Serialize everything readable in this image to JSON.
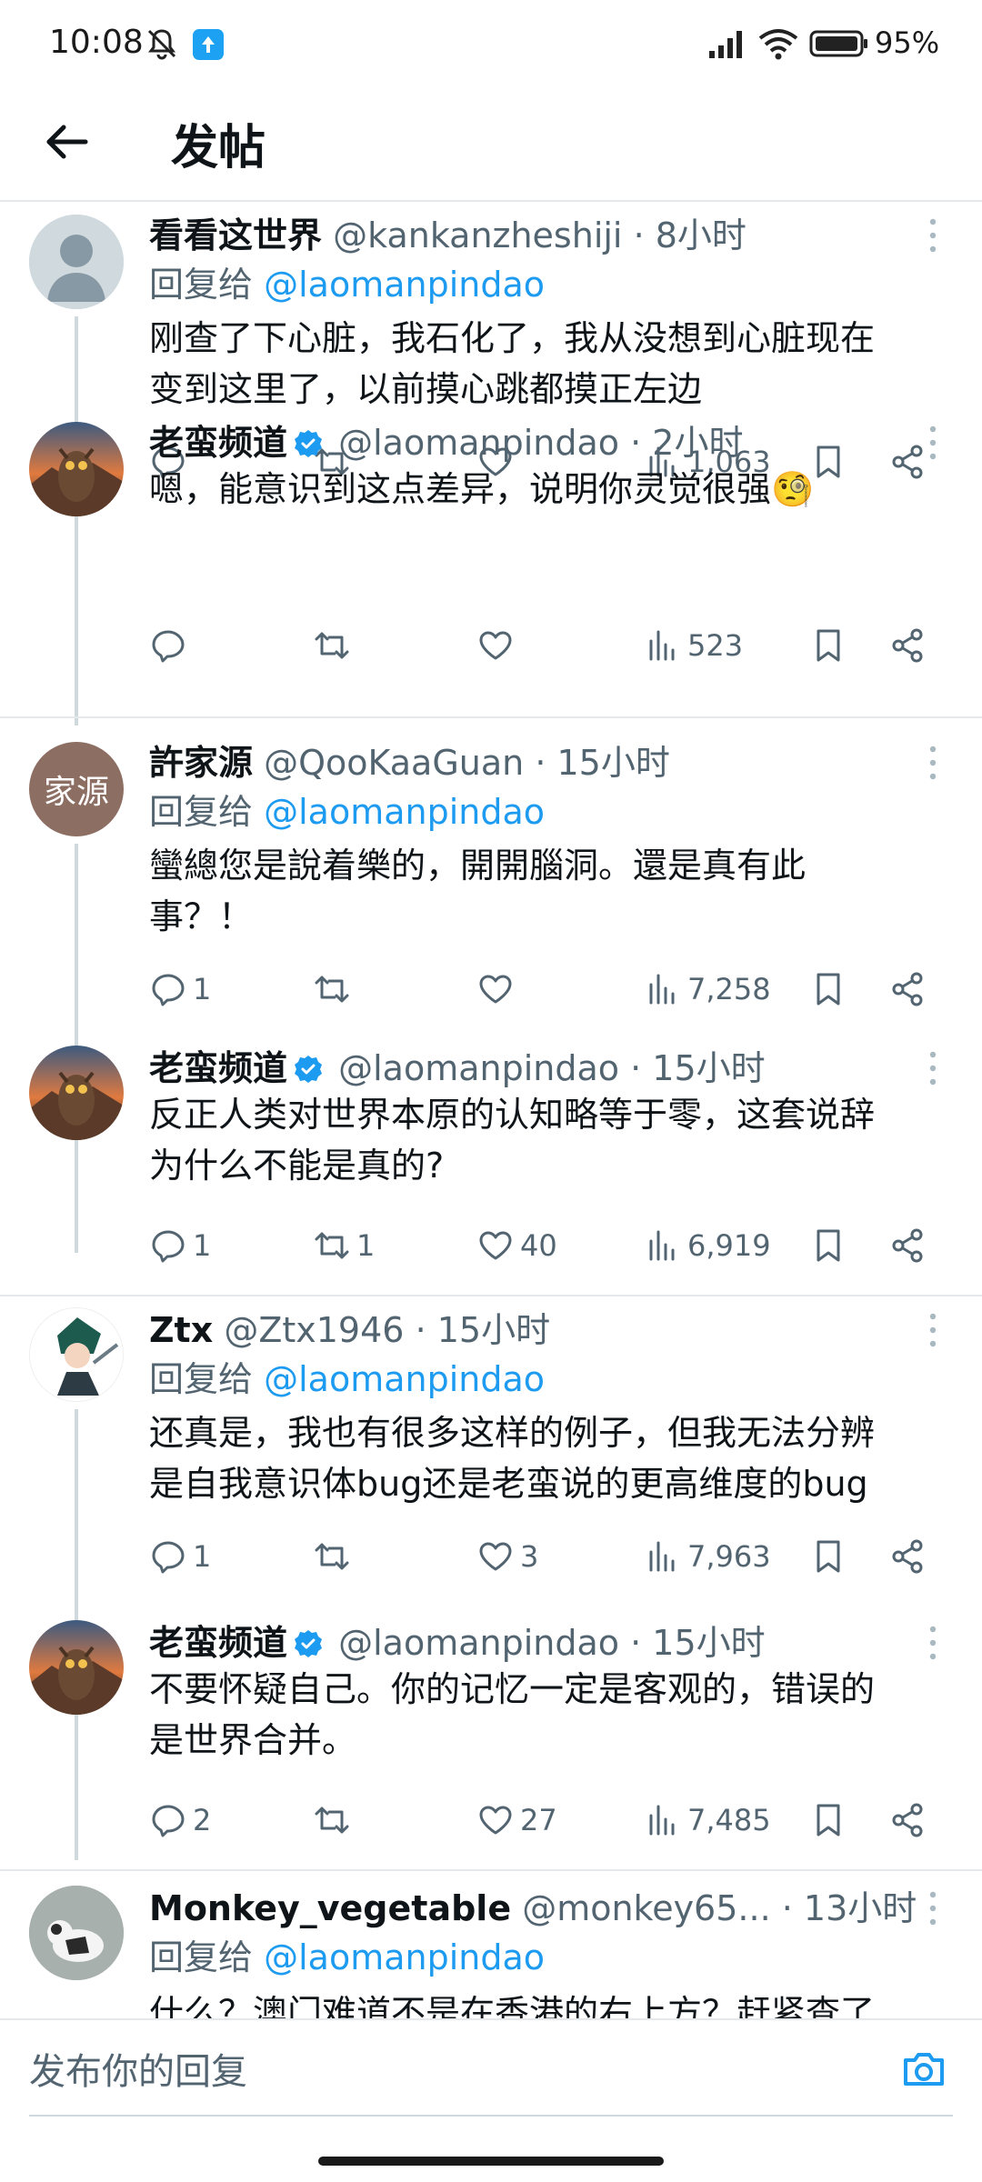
{
  "status_bar": {
    "time": "10:08",
    "battery": "95%"
  },
  "header": {
    "title": "发帖"
  },
  "colors": {
    "accent": "#1d9bf0",
    "secondary_text": "#536471",
    "divider": "#e6e9ec"
  },
  "tweets": [
    {
      "name": "看看这世界",
      "handle": "@kankanzheshiji",
      "time": "· 8小时",
      "verified": false,
      "reply_label": "回复给",
      "reply_handle": "@laomanpindao",
      "text": "刚查了下心脏，我石化了，我从没想到心脏现在\n变到这里了，以前摸心跳都摸正左边",
      "replies": "",
      "retweets": "",
      "likes": "",
      "views": "1,063"
    },
    {
      "name": "老蛮频道",
      "handle": "@laomanpindao",
      "time": "· 2小时",
      "verified": true,
      "text": "嗯，能意识到这点差异，说明你灵觉很强🧐",
      "replies": "",
      "retweets": "",
      "likes": "",
      "views": "523"
    },
    {
      "name": "許家源",
      "handle": "@QooKaaGuan",
      "time": "· 15小时",
      "verified": false,
      "avatar_text": "家源",
      "reply_label": "回复给",
      "reply_handle": "@laomanpindao",
      "text": "蠻總您是說着樂的，開開腦洞。還是真有此\n事？！",
      "replies": "1",
      "retweets": "",
      "likes": "",
      "views": "7,258"
    },
    {
      "name": "老蛮频道",
      "handle": "@laomanpindao",
      "time": "· 15小时",
      "verified": true,
      "text": "反正人类对世界本原的认知略等于零，这套说辞\n为什么不能是真的?",
      "replies": "1",
      "retweets": "1",
      "likes": "40",
      "views": "6,919"
    },
    {
      "name": "Ztx",
      "handle": "@Ztx1946",
      "time": "· 15小时",
      "verified": false,
      "reply_label": "回复给",
      "reply_handle": "@laomanpindao",
      "text": "还真是，我也有很多这样的例子，但我无法分辨\n是自我意识体bug还是老蛮说的更高维度的bug",
      "replies": "1",
      "retweets": "",
      "likes": "3",
      "views": "7,963"
    },
    {
      "name": "老蛮频道",
      "handle": "@laomanpindao",
      "time": "· 15小时",
      "verified": true,
      "text": "不要怀疑自己。你的记忆一定是客观的，错误的\n是世界合并。",
      "replies": "2",
      "retweets": "",
      "likes": "27",
      "views": "7,485"
    },
    {
      "name": "Monkey_vegetable",
      "handle": "@monkey65...",
      "time": "· 13小时",
      "verified": false,
      "reply_label": "回复给",
      "reply_handle": "@laomanpindao",
      "text": "什么？澳门难道不是在香港的右上方？赶紧查了"
    }
  ],
  "compose": {
    "placeholder": "发布你的回复"
  }
}
